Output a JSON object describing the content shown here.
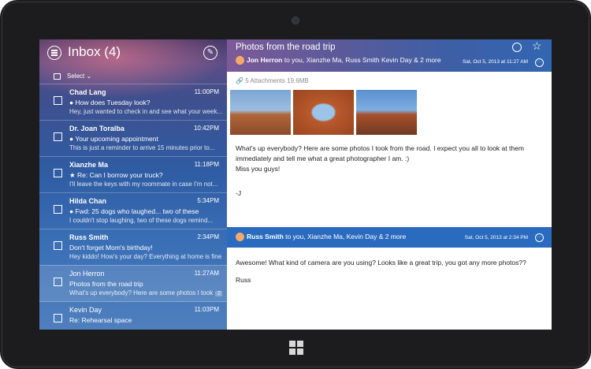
{
  "inbox": {
    "title": "Inbox (4)",
    "select_label": "Select ⌄"
  },
  "messages": [
    {
      "from": "Chad Lang",
      "time": "11:00PM",
      "subject": "● How does Tuesday look?",
      "preview": "Hey, just wanted to check in and see what your week..."
    },
    {
      "from": "Dr. Joan Toralba",
      "time": "10:42PM",
      "subject": "● Your upcoming appointment",
      "preview": "This is just a reminder to arrive 15 minutes prior to..."
    },
    {
      "from": "Xianzhe Ma",
      "time": "11:18PM",
      "subject": "★ Re: Can I borrow your truck?",
      "preview": "I'll leave the keys with my roommate in case I'm not..."
    },
    {
      "from": "Hilda Chan",
      "time": "5:34PM",
      "subject": "● Fwd: 25 dogs who laughed... two of these",
      "preview": "I couldn't stop laughing, two of these dogs remind..."
    },
    {
      "from": "Russ Smith",
      "time": "2:34PM",
      "subject": "Don't forget Mom's birthday!",
      "preview": "Hey kiddo! How's your day? Everything at home is fine..."
    },
    {
      "from": "Jon Herron",
      "time": "11:27AM",
      "subject": "Photos from the road trip",
      "preview": "What's up everybody? Here are some photos I took",
      "badge": "2"
    },
    {
      "from": "Kevin Day",
      "time": "11:03PM",
      "subject": "Re: Rehearsal space",
      "preview": ""
    }
  ],
  "reading": {
    "title": "Photos from the road trip",
    "msg1": {
      "sender": "Jon Herron",
      "recipients": "to you, Xianzhe Ma, Russ Smith Kevin Day & 2 more",
      "date": "Sat, Oct 5, 2013 at 11:27 AM",
      "attachments": "5 Attachments  19.6MB",
      "body_line1": "What's up everybody? Here are some photos I took from the road. I expect you all to look at them",
      "body_line2": "immediately and tell me what a great photographer I am. :)",
      "body_line3": "Miss you guys!",
      "signature": "-J"
    },
    "msg2": {
      "sender": "Russ Smith",
      "recipients": "to you, Xianzhe Ma, Kevin Day & 2 more",
      "date": "Sat, Oct 5, 2013 at 2:34 PM",
      "body": "Awesome! What kind of camera are you using? Looks like a great trip, you got any more photos??",
      "signature": "Russ"
    }
  },
  "colors": {
    "accent": "#2b6bbf",
    "bezel": "#1c1c1e",
    "avatar": "#f4a86a"
  },
  "icons": [
    "menu-icon",
    "compose-icon",
    "circle-icon",
    "star-icon",
    "more-icon",
    "paperclip-icon",
    "windows-logo-icon"
  ]
}
